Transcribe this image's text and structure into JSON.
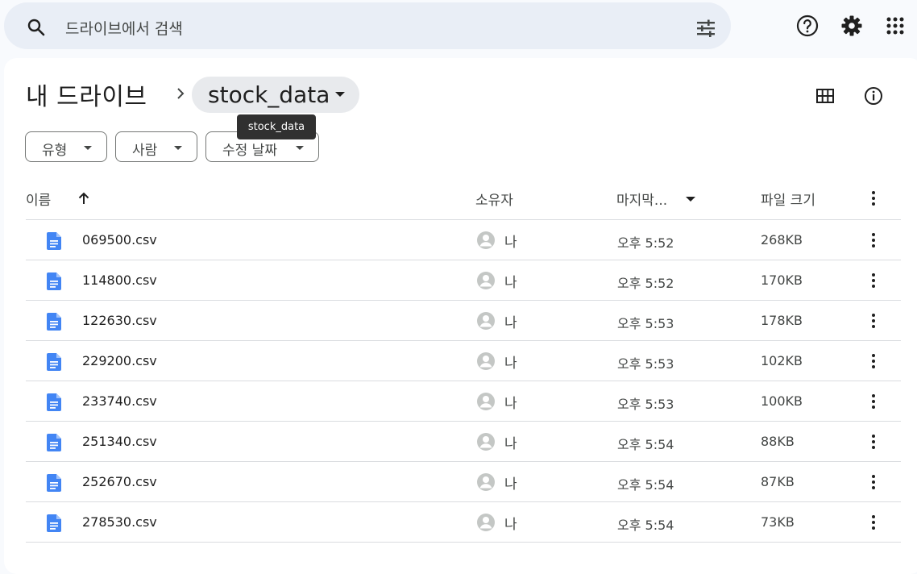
{
  "search": {
    "placeholder": "드라이브에서 검색"
  },
  "breadcrumb": {
    "root": "내 드라이브",
    "current": "stock_data"
  },
  "tooltip": "stock_data",
  "filters": [
    {
      "label": "유형"
    },
    {
      "label": "사람"
    },
    {
      "label": "수정 날짜"
    }
  ],
  "table": {
    "columns": {
      "name": "이름",
      "owner": "소유자",
      "modified": "마지막...",
      "size": "파일 크기"
    },
    "rows": [
      {
        "name": "069500.csv",
        "owner": "나",
        "modified": "오후 5:52",
        "size": "268KB"
      },
      {
        "name": "114800.csv",
        "owner": "나",
        "modified": "오후 5:52",
        "size": "170KB"
      },
      {
        "name": "122630.csv",
        "owner": "나",
        "modified": "오후 5:53",
        "size": "178KB"
      },
      {
        "name": "229200.csv",
        "owner": "나",
        "modified": "오후 5:53",
        "size": "102KB"
      },
      {
        "name": "233740.csv",
        "owner": "나",
        "modified": "오후 5:53",
        "size": "100KB"
      },
      {
        "name": "251340.csv",
        "owner": "나",
        "modified": "오후 5:54",
        "size": "88KB"
      },
      {
        "name": "252670.csv",
        "owner": "나",
        "modified": "오후 5:54",
        "size": "87KB"
      },
      {
        "name": "278530.csv",
        "owner": "나",
        "modified": "오후 5:54",
        "size": "73KB"
      }
    ]
  },
  "icons": {
    "search": "search-icon",
    "filter": "tune-icon",
    "help": "help-icon",
    "settings": "gear-icon",
    "apps": "apps-grid-icon",
    "grid": "grid-view-icon",
    "info": "info-icon",
    "file": "doc-file-icon"
  },
  "colors": {
    "file_icon": "#4285f4",
    "chip_bg": "#e9eef6"
  }
}
